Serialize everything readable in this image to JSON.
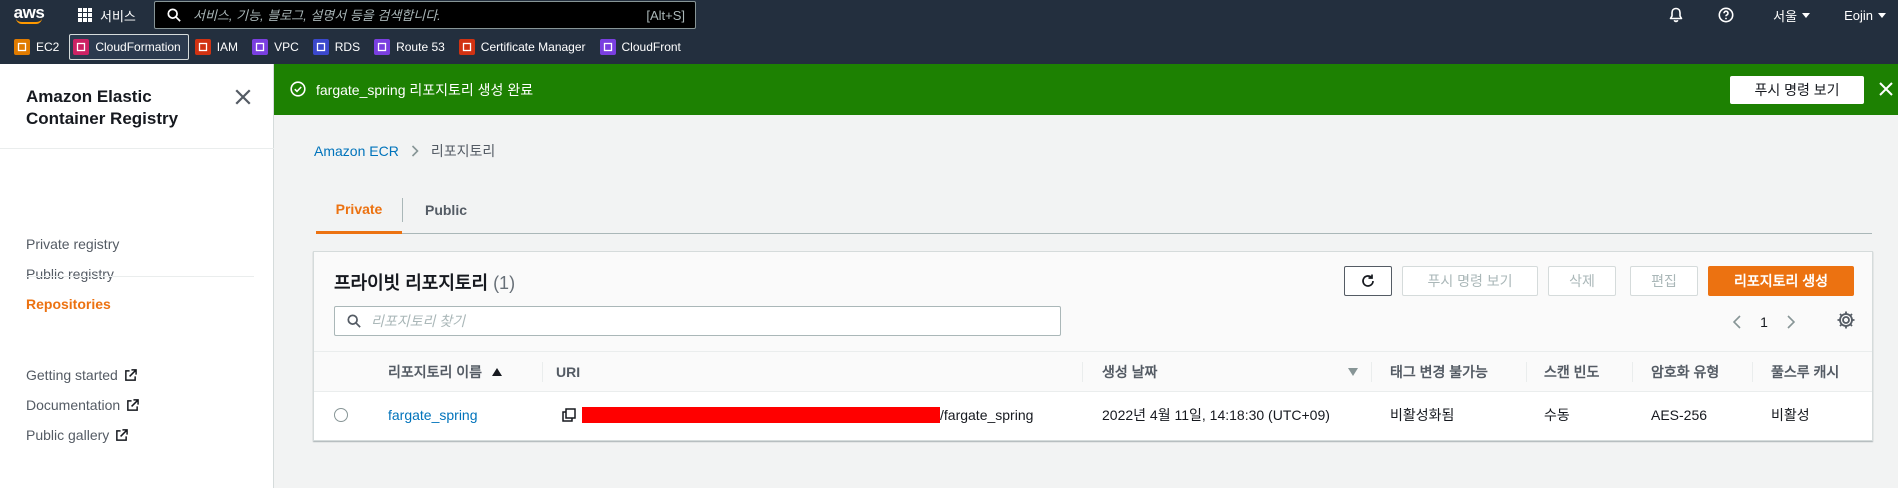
{
  "topnav": {
    "logo_text": "aws",
    "services_label": "서비스",
    "search_placeholder": "서비스, 기능, 블로그, 설명서 등을 검색합니다.",
    "search_shortcut": "[Alt+S]",
    "region": "서울",
    "user": "Eojin"
  },
  "favorites": [
    {
      "label": "EC2",
      "icon": "ec2-icon",
      "color": "#e07b00"
    },
    {
      "label": "CloudFormation",
      "icon": "cloudformation-icon",
      "color": "#cc2264"
    },
    {
      "label": "IAM",
      "icon": "iam-icon",
      "color": "#d13212"
    },
    {
      "label": "VPC",
      "icon": "vpc-icon",
      "color": "#7a3fe0"
    },
    {
      "label": "RDS",
      "icon": "rds-icon",
      "color": "#3b48cc"
    },
    {
      "label": "Route 53",
      "icon": "route53-icon",
      "color": "#7a3fe0"
    },
    {
      "label": "Certificate Manager",
      "icon": "certificate-manager-icon",
      "color": "#d13212"
    },
    {
      "label": "CloudFront",
      "icon": "cloudfront-icon",
      "color": "#7a3fe0"
    }
  ],
  "sidebar": {
    "title": "Amazon Elastic Container Registry",
    "links": [
      {
        "label": "Private registry",
        "active": false
      },
      {
        "label": "Public registry",
        "active": false
      },
      {
        "label": "Repositories",
        "active": true
      }
    ],
    "external_links": [
      {
        "label": "Getting started"
      },
      {
        "label": "Documentation"
      },
      {
        "label": "Public gallery"
      }
    ]
  },
  "flash": {
    "message": "fargate_spring 리포지토리 생성 완료",
    "button": "푸시 명령 보기",
    "color": "#1d8102"
  },
  "breadcrumb": {
    "root": "Amazon ECR",
    "current": "리포지토리"
  },
  "tabs": [
    {
      "label": "Private",
      "active": true
    },
    {
      "label": "Public",
      "active": false
    }
  ],
  "panel": {
    "title": "프라이빗 리포지토리",
    "count": "(1)",
    "buttons": {
      "push": "푸시 명령 보기",
      "delete": "삭제",
      "edit": "편집",
      "create": "리포지토리 생성"
    },
    "search_placeholder": "리포지토리 찾기",
    "page": "1"
  },
  "table": {
    "columns": [
      "리포지토리 이름",
      "URI",
      "생성 날짜",
      "태그 변경 불가능",
      "스캔 빈도",
      "암호화 유형",
      "풀스루 캐시"
    ],
    "rows": [
      {
        "name": "fargate_spring",
        "uri_suffix": "/fargate_spring",
        "created": "2022년 4월 11일, 14:18:30 (UTC+09)",
        "tag_immutability": "비활성화됨",
        "scan_frequency": "수동",
        "encryption": "AES-256",
        "pull_through": "비활성"
      }
    ]
  },
  "colors": {
    "accent": "#ec7211",
    "link": "#0073bb",
    "nav": "#232f3e",
    "redaction": "#ff0000"
  }
}
